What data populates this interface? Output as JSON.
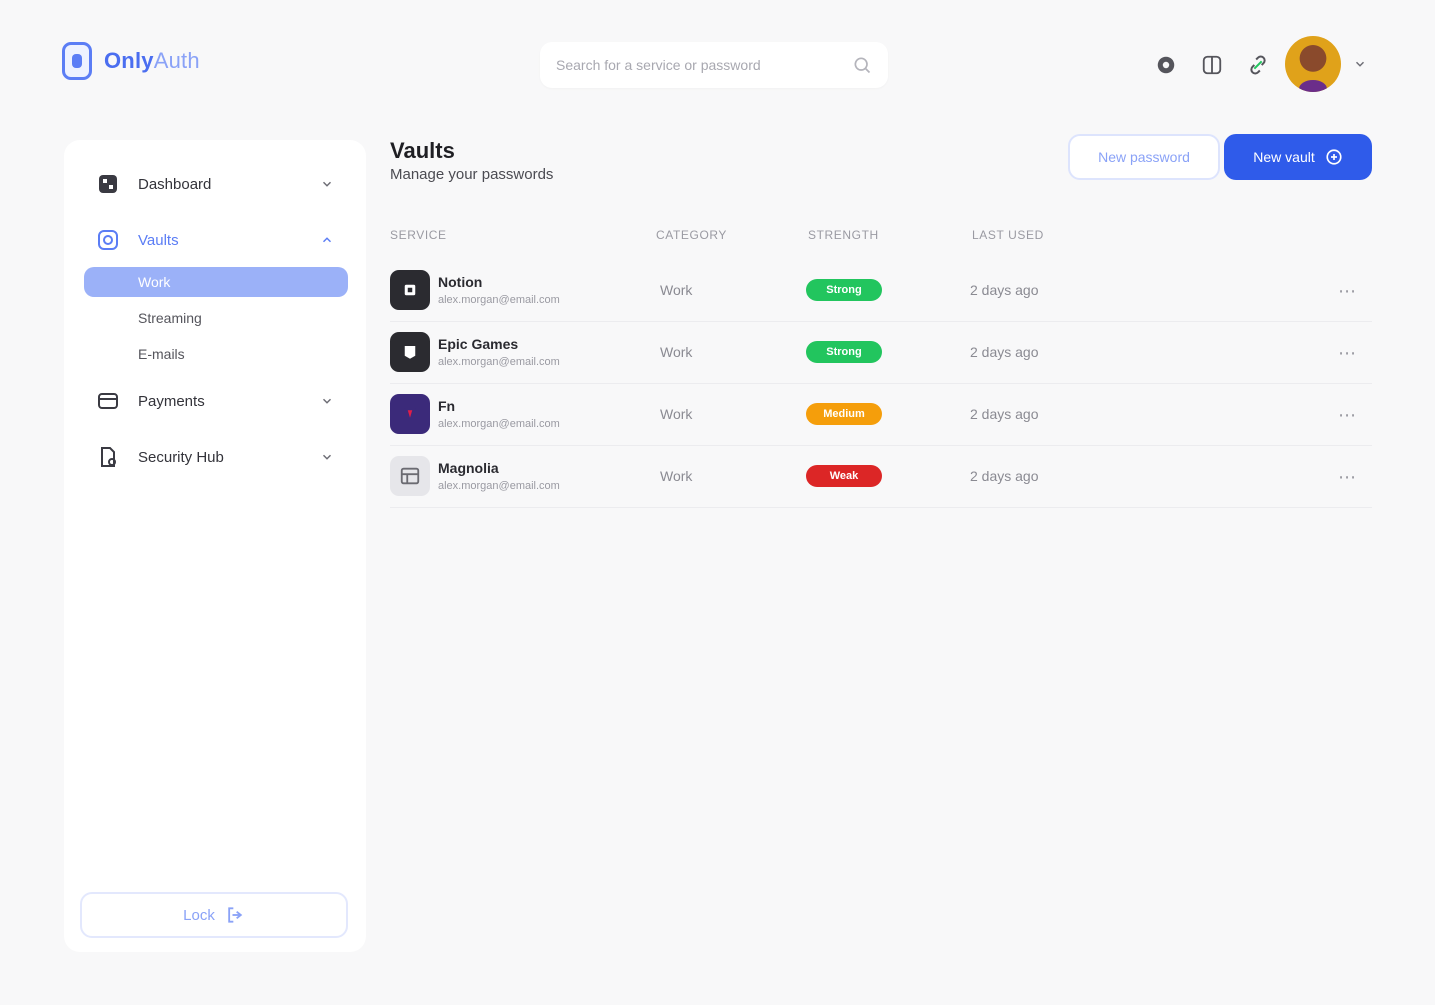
{
  "brand": {
    "name_bold": "Only",
    "name_light": "Auth"
  },
  "search": {
    "placeholder": "Search for a service or password"
  },
  "header": {
    "icons": [
      "settings-icon",
      "grid-icon",
      "link-icon"
    ]
  },
  "sidebar": {
    "items": [
      {
        "label": "Dashboard",
        "icon": "dashboard-icon"
      },
      {
        "label": "Vaults",
        "icon": "vault-icon"
      },
      {
        "label": "Payments",
        "icon": "payments-icon"
      },
      {
        "label": "Security Hub",
        "icon": "security-icon"
      }
    ],
    "vault_subitems": [
      "Work",
      "Streaming",
      "E-mails"
    ],
    "lock_label": "Lock"
  },
  "main": {
    "title": "Vaults",
    "subtitle": "Manage your passwords",
    "new_password_label": "New password",
    "new_vault_label": "New vault"
  },
  "table": {
    "headers": [
      "Service",
      "Category",
      "Strength",
      "Last used"
    ],
    "rows": [
      {
        "name": "Notion",
        "email": "alex.morgan@email.com",
        "category": "Work",
        "strength": "Strong",
        "strength_color": "#22c55e",
        "last_used": "2 days ago",
        "icon": "notion-icon",
        "icon_bg": "#2b2b30"
      },
      {
        "name": "Epic Games",
        "email": "alex.morgan@email.com",
        "category": "Work",
        "strength": "Strong",
        "strength_color": "#22c55e",
        "last_used": "2 days ago",
        "icon": "epic-games-icon",
        "icon_bg": "#2b2b30"
      },
      {
        "name": "Fn",
        "email": "alex.morgan@email.com",
        "category": "Work",
        "strength": "Medium",
        "strength_color": "#f59e0b",
        "last_used": "2 days ago",
        "icon": "fn-icon",
        "icon_bg": "#3b2a7a"
      },
      {
        "name": "Magnolia",
        "email": "alex.morgan@email.com",
        "category": "Work",
        "strength": "Weak",
        "strength_color": "#dc2626",
        "last_used": "2 days ago",
        "icon": "magnolia-icon",
        "icon_bg": "#e6e6ea"
      }
    ]
  },
  "colors": {
    "accent": "#2f5bea",
    "accent_light": "#5b7df5",
    "sub_active_bg": "#9bb1f8"
  }
}
